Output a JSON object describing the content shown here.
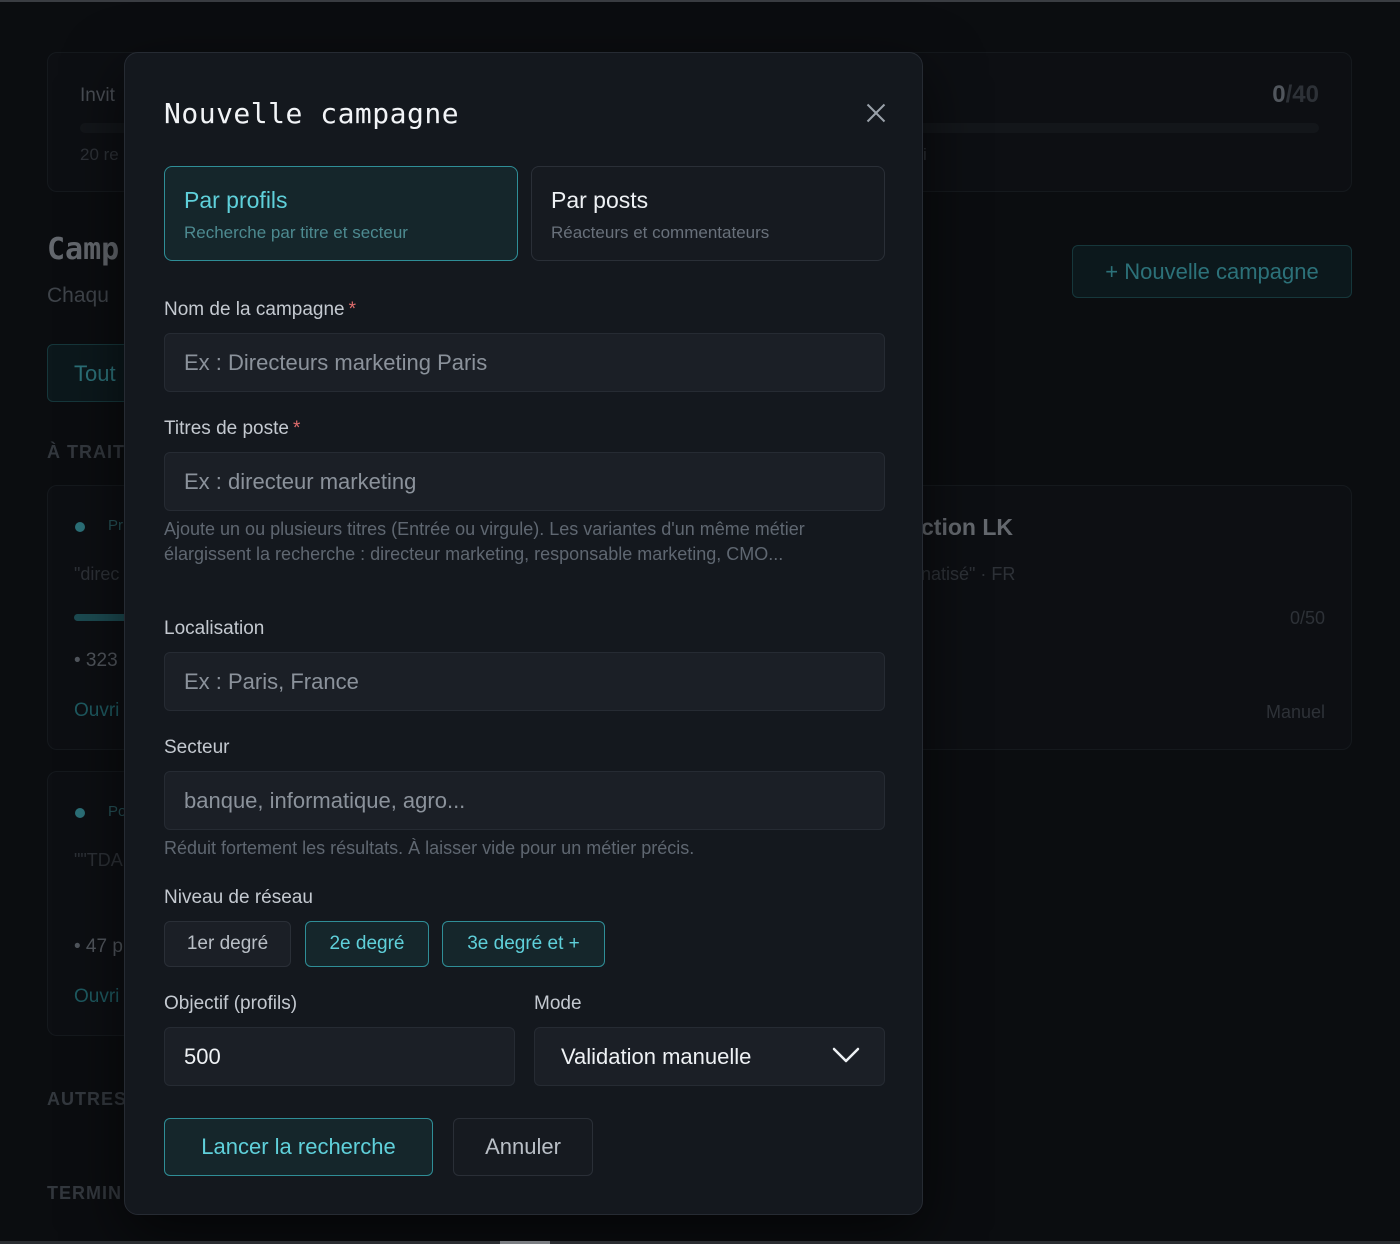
{
  "background": {
    "quota": {
      "label": "Invit",
      "count_used": "0",
      "count_total": "/40",
      "sub_left": "20 re",
      "sub_right": "i"
    },
    "section_title": "Camp",
    "section_subtitle": "Chaqu",
    "new_campaign_button": "+ Nouvelle campagne",
    "filter_all": "Tout",
    "group_to_process": "À TRAIT",
    "group_others": "AUTRES",
    "group_done": "TERMIN",
    "cards": [
      {
        "tag": "Pr",
        "query": "\"direc",
        "stat": "• 323",
        "open_link": "Ouvri"
      },
      {
        "title": "ction LK",
        "meta": "natisé\" · FR",
        "progress_text": "0/50",
        "mode": "Manuel"
      },
      {
        "tag": "Po",
        "query": "\"\"TDA",
        "stat": "• 47 p",
        "open_link": "Ouvri"
      }
    ]
  },
  "modal": {
    "title": "Nouvelle campagne",
    "search_modes": [
      {
        "title": "Par profils",
        "subtitle": "Recherche par titre et secteur",
        "active": true
      },
      {
        "title": "Par posts",
        "subtitle": "Réacteurs et commentateurs",
        "active": false
      }
    ],
    "fields": {
      "campaign_name": {
        "label": "Nom de la campagne",
        "required_mark": "*",
        "placeholder": "Ex : Directeurs marketing Paris"
      },
      "job_titles": {
        "label": "Titres de poste",
        "required_mark": "*",
        "placeholder": "Ex : directeur marketing",
        "help": "Ajoute un ou plusieurs titres (Entrée ou virgule). Les variantes d'un même métier élargissent la recherche : directeur marketing, responsable marketing, CMO..."
      },
      "location": {
        "label": "Localisation",
        "placeholder": "Ex : Paris, France"
      },
      "sector": {
        "label": "Secteur",
        "placeholder": "banque, informatique, agro...",
        "help": "Réduit fortement les résultats. À laisser vide pour un métier précis."
      },
      "network_level": {
        "label": "Niveau de réseau",
        "options": [
          {
            "label": "1er degré",
            "selected": false
          },
          {
            "label": "2e degré",
            "selected": true
          },
          {
            "label": "3e degré et +",
            "selected": true
          }
        ]
      },
      "target": {
        "label": "Objectif (profils)",
        "value": "500"
      },
      "mode": {
        "label": "Mode",
        "value": "Validation manuelle"
      }
    },
    "actions": {
      "launch": "Lancer la recherche",
      "cancel": "Annuler"
    }
  },
  "colors": {
    "accent": "#5fd0da",
    "accent_border": "#2f8e97",
    "required": "#e06d6d",
    "modal_bg": "#14181e",
    "page_bg": "#0b0d10"
  }
}
